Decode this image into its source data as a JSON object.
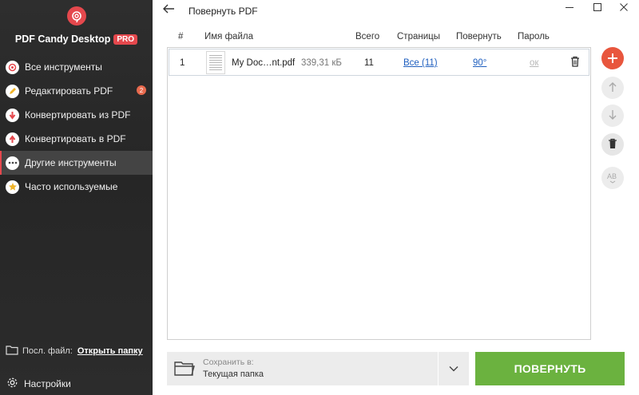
{
  "app": {
    "name": "PDF Candy Desktop",
    "badge": "PRO"
  },
  "sidebar": {
    "items": [
      {
        "label": "Все инструменты",
        "icon": "all-tools-icon",
        "color": "#e5484d"
      },
      {
        "label": "Редактировать PDF",
        "icon": "edit-pdf-icon",
        "color": "#f0b429",
        "badge": "2"
      },
      {
        "label": "Конвертировать из PDF",
        "icon": "convert-from-pdf-icon",
        "color": "#e5484d"
      },
      {
        "label": "Конвертировать в PDF",
        "icon": "convert-to-pdf-icon",
        "color": "#e5484d"
      },
      {
        "label": "Другие инструменты",
        "icon": "more-tools-icon",
        "color": "#ffffff",
        "active": true
      },
      {
        "label": "Часто используемые",
        "icon": "star-icon",
        "color": "#f0b429"
      }
    ],
    "last_file_label": "Посл. файл:",
    "last_file_link": "Открыть папку",
    "settings_label": "Настройки"
  },
  "window": {
    "title": "Повернуть PDF"
  },
  "table": {
    "headers": {
      "num": "#",
      "filename": "Имя файла",
      "total": "Всего",
      "pages": "Страницы",
      "rotate": "Повернуть",
      "password": "Пароль"
    },
    "rows": [
      {
        "num": "1",
        "filename": "My Doc…nt.pdf",
        "size": "339,31 кБ",
        "total": "11",
        "pages": "Все (11)",
        "rotate": "90°",
        "password": "ок"
      }
    ]
  },
  "save": {
    "label": "Сохранить в:",
    "value": "Текущая папка"
  },
  "primary_button": "ПОВЕРНУТЬ",
  "colors": {
    "accent": "#e5484d",
    "primary": "#6bb23f",
    "link": "#1f5fbf"
  }
}
